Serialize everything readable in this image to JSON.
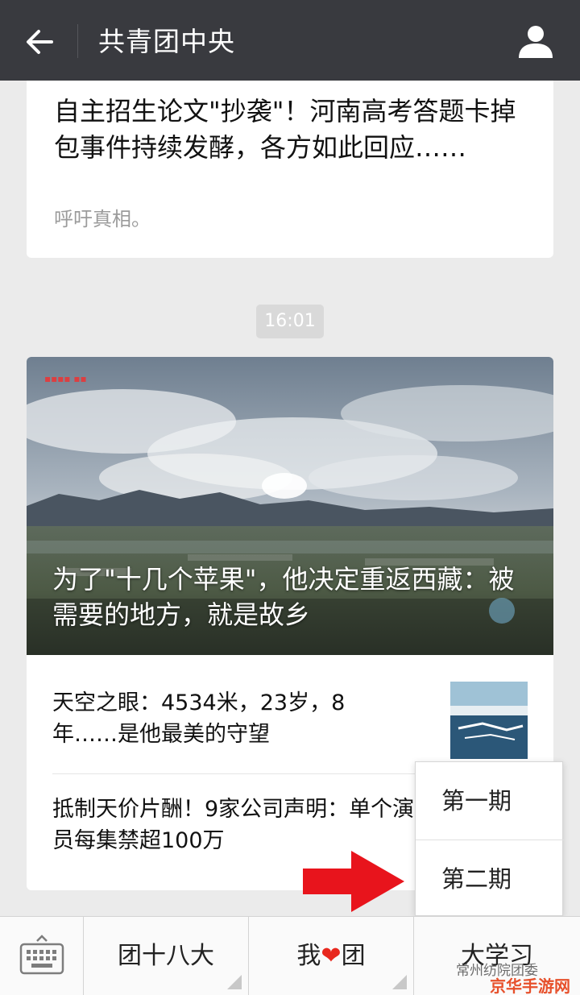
{
  "header": {
    "title": "共青团中央"
  },
  "messages": {
    "card1": {
      "title": "自主招生论文\"抄袭\"！河南高考答题卡掉包事件持续发酵，各方如此回应……",
      "desc": "呼吁真相。"
    },
    "time": "16:01",
    "card2": {
      "hero_caption": "为了\"十几个苹果\"，他决定重返西藏：被需要的地方，就是故乡",
      "items": [
        {
          "title": "天空之眼：4534米，23岁，8年……是他最美的守望"
        },
        {
          "title": "抵制天价片酬！9家公司声明：单个演员每集禁超100万"
        }
      ]
    }
  },
  "popup": {
    "items": [
      "第一期",
      "第二期"
    ]
  },
  "bottom_bar": {
    "menus": [
      "团十八大",
      "我",
      "团",
      "大学习"
    ]
  },
  "watermark": {
    "line1": "常州纺院团委",
    "line2": "京华手游网"
  },
  "colors": {
    "header_bg": "#393a3f",
    "page_bg": "#ebebeb",
    "arrow": "#e8141c",
    "heart": "#e8281e"
  },
  "icons": [
    "back-arrow-icon",
    "profile-icon",
    "keyboard-icon",
    "heart-icon",
    "red-arrow-icon"
  ]
}
